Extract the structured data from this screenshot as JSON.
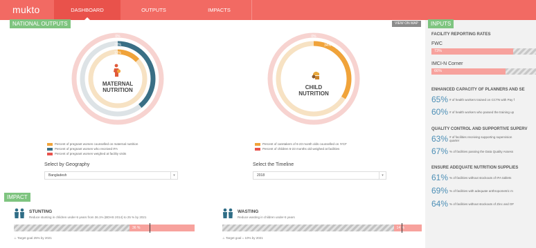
{
  "app": {
    "logo": "mukto",
    "nav": [
      {
        "label": "DASHBOARD",
        "active": true
      },
      {
        "label": "OUTPUTS",
        "active": false
      },
      {
        "label": "IMPACTS",
        "active": false
      }
    ]
  },
  "national_outputs": {
    "title": "NATIONAL OUTPUTS",
    "view_on_map": "VIEW ON MAP",
    "maternal": {
      "title_line1": "MATERNAL",
      "title_line2": "NUTRITION",
      "values": {
        "outer": "0%",
        "middle": "39%",
        "inner": "13%"
      },
      "fractions": {
        "outer": 0.0,
        "middle": 0.39,
        "inner": 0.13
      },
      "legend": [
        {
          "label": "Percent of pregnant women counselled on maternal nutrition",
          "color": "#f0a33a"
        },
        {
          "label": "Percent of pregnant women who received IFA",
          "color": "#3a6f85"
        },
        {
          "label": "Percent of pregnant women weighed at facility visits",
          "color": "#e8524c"
        }
      ],
      "select_label": "Select by Geography",
      "select_value": "Bangladesh"
    },
    "child": {
      "title_line1": "CHILD",
      "title_line2": "NUTRITION",
      "values": {
        "outer": "0%",
        "inner": "34%"
      },
      "fractions": {
        "outer": 0.0,
        "inner": 0.34
      },
      "legend": [
        {
          "label": "Percent of caretakers of 6-23 month olds counselled on IYCF",
          "color": "#f0a33a"
        },
        {
          "label": "Percent of children 6-23 months old weighed at facilities",
          "color": "#e8524c"
        }
      ],
      "select_label": "Select the Timeline",
      "select_value": "2018"
    }
  },
  "impact": {
    "title": "IMPACT",
    "stunting": {
      "title": "STUNTING",
      "desc": "Reduce stunting in children under-5 years from 36.1% (BDHS 2014) to 25 % by 2021",
      "value": "36 %",
      "fraction": 0.36,
      "target_fraction": 0.25,
      "target_text": "Target goal 25% by 2021"
    },
    "wasting": {
      "title": "WASTING",
      "desc": "Reduce wasting in children under-5 years",
      "value": "14 %",
      "fraction": 0.14,
      "target_fraction": 0.1,
      "target_text": "Target goal = 10% by 2021"
    }
  },
  "inputs": {
    "title": "INPUTS",
    "facility_reporting": {
      "heading": "FACILITY REPORTING RATES",
      "items": [
        {
          "label": "FWC",
          "value": "73%",
          "fraction": 0.73
        },
        {
          "label": "IMCI-N Corner",
          "value": "66%",
          "fraction": 0.66
        }
      ]
    },
    "capacity": {
      "heading": "ENHANCED CAPACITY OF PLANNERS AND SE",
      "items": [
        {
          "pct": "65%",
          "desc": "# of health workers trained on CCTN with Pay f"
        },
        {
          "pct": "60%",
          "desc": "# of health workers who passed the training up"
        }
      ]
    },
    "quality": {
      "heading": "QUALITY CONTROL AND SUPPORTIVE SUPERV",
      "items": [
        {
          "pct": "63%",
          "desc": "# of facilities receiving supporting supervision",
          "desc2": "quarter"
        },
        {
          "pct": "67%",
          "desc": "% of facilities passing the Data Quality Assess"
        }
      ]
    },
    "supplies": {
      "heading": "ENSURE ADEQUATE NUTRITION SUPPLIES",
      "items": [
        {
          "pct": "61%",
          "desc": "% of facilities without stockouts of IFA tablets"
        },
        {
          "pct": "69%",
          "desc": "% of facilities with adequate anthropometric m"
        },
        {
          "pct": "64%",
          "desc": "% of facilities without stockouts of Zinc and OF"
        }
      ]
    }
  }
}
